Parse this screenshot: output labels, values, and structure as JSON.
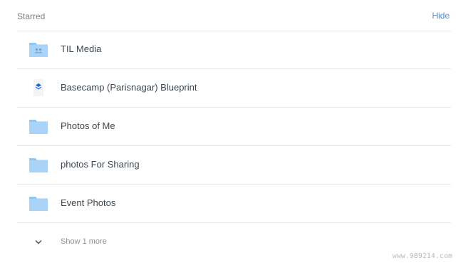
{
  "header": {
    "title": "Starred",
    "hide_label": "Hide"
  },
  "items": [
    {
      "label": "TIL Media",
      "icon": "shared-folder-icon"
    },
    {
      "label": "Basecamp (Parisnagar) Blueprint",
      "icon": "paper-doc-icon"
    },
    {
      "label": "Photos of Me",
      "icon": "folder-icon"
    },
    {
      "label": "photos For Sharing",
      "icon": "folder-icon"
    },
    {
      "label": "Event Photos",
      "icon": "folder-icon"
    }
  ],
  "more": {
    "label": "Show 1 more",
    "icon": "chevron-down-icon"
  },
  "watermark": "www.989214.com",
  "colors": {
    "folder": "#a9d3f7",
    "folder_tab": "#91c5f2",
    "accent": "#4f8fd0",
    "divider": "#e6e8eb"
  }
}
